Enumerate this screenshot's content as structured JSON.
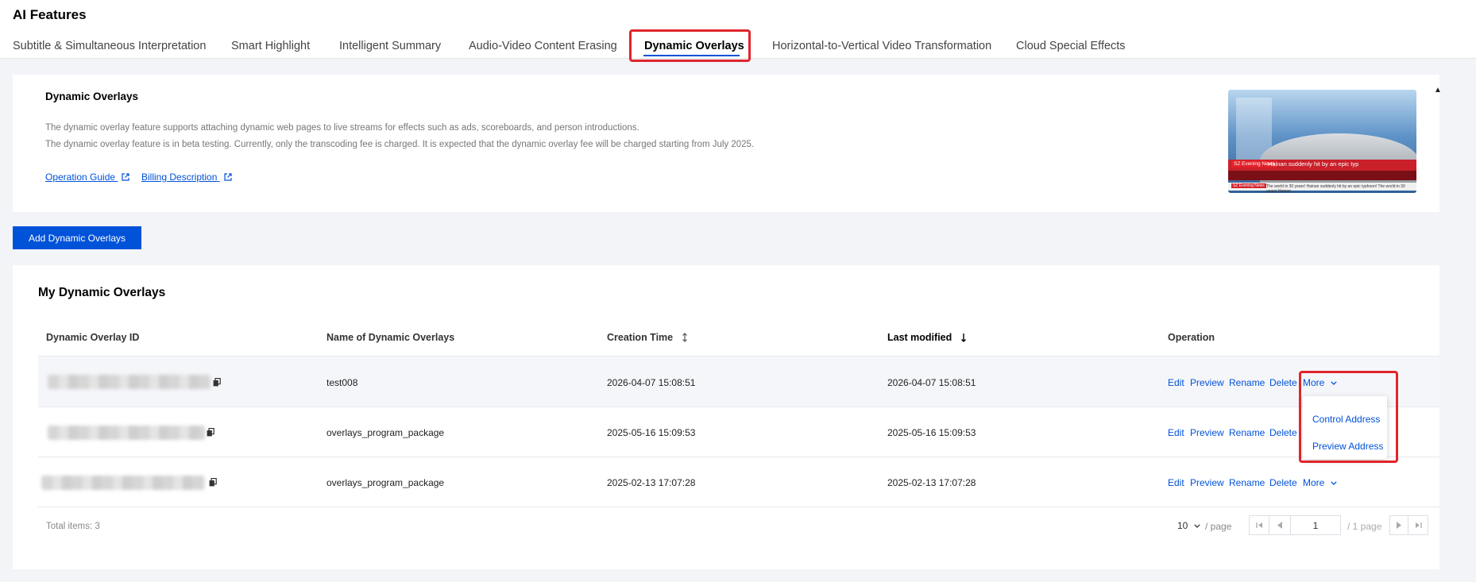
{
  "header": {
    "title": "AI Features",
    "tabs": [
      {
        "label": "Subtitle & Simultaneous Interpretation"
      },
      {
        "label": "Smart Highlight"
      },
      {
        "label": "Intelligent Summary"
      },
      {
        "label": "Audio-Video Content Erasing"
      },
      {
        "label": "Dynamic Overlays",
        "active": true
      },
      {
        "label": "Horizontal-to-Vertical Video Transformation"
      },
      {
        "label": "Cloud Special Effects"
      }
    ]
  },
  "intro": {
    "title": "Dynamic Overlays",
    "line1": "The dynamic overlay feature supports attaching dynamic web pages to live streams for effects such as ads, scoreboards, and person introductions.",
    "line2": "The dynamic overlay feature is in beta testing. Currently, only the transcoding fee is charged. It is expected that the dynamic overlay fee will be charged starting from July 2025.",
    "link_guide": "Operation Guide",
    "link_billing": "Billing Description",
    "banner": {
      "tag1": "SZ Evening News",
      "tag2": "Hainan suddenly hit by an epic typ",
      "tag3": "SZ Evening News",
      "ticker": "The world in 30 years! Hainan suddenly hit by an epic typhoon! The world in 30 years! Hainan"
    }
  },
  "add_button": "Add Dynamic Overlays",
  "list": {
    "title": "My Dynamic Overlays",
    "columns": {
      "id": "Dynamic Overlay ID",
      "name": "Name of Dynamic Overlays",
      "created": "Creation Time",
      "modified": "Last modified",
      "operation": "Operation"
    },
    "rows": [
      {
        "name": "test008",
        "created": "2026-04-07 15:08:51",
        "modified": "2026-04-07 15:08:51"
      },
      {
        "name": "overlays_program_package",
        "created": "2025-05-16 15:09:53",
        "modified": "2025-05-16 15:09:53"
      },
      {
        "name": "overlays_program_package",
        "created": "2025-02-13 17:07:28",
        "modified": "2025-02-13 17:07:28"
      }
    ],
    "ops": {
      "edit": "Edit",
      "preview": "Preview",
      "rename": "Rename",
      "delete": "Delete",
      "more": "More"
    },
    "dropdown": [
      "Control Address",
      "Preview Address"
    ]
  },
  "pagination": {
    "total": "Total items: 3",
    "page_size": "10",
    "per_page": "/ page",
    "current": "1",
    "total_pages": "/ 1 page"
  },
  "colors": {
    "accent": "#0052d9",
    "highlight": "#e0252c"
  }
}
